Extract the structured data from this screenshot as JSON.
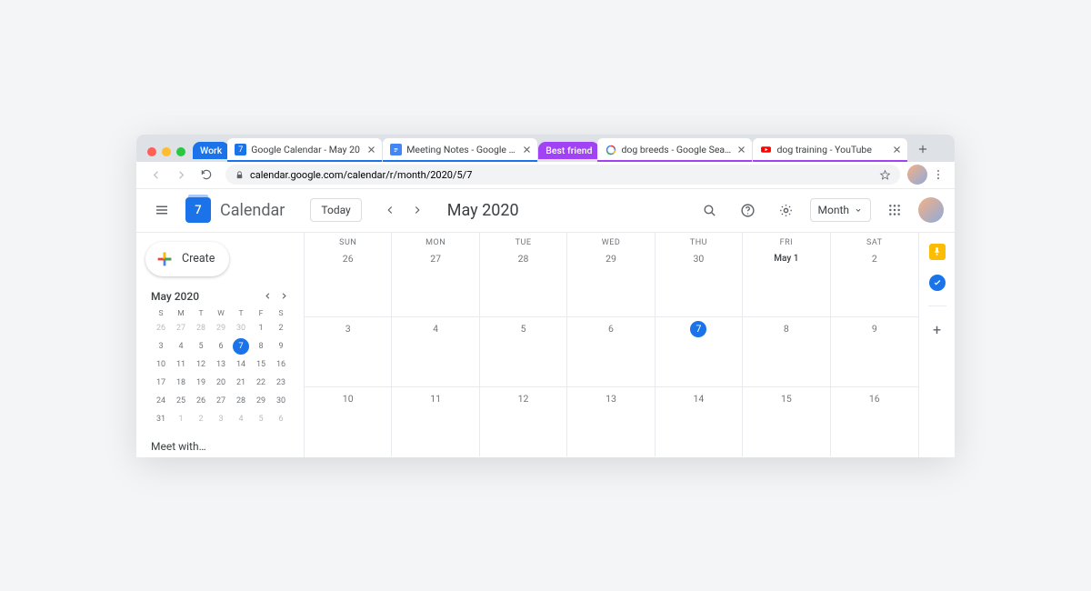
{
  "browser": {
    "tab_groups": [
      {
        "name": "work",
        "label": "Work",
        "color": "#1a73e8",
        "underline": "#1a73e8"
      },
      {
        "name": "bestfriend",
        "label": "Best friend",
        "color": "#a142f4",
        "underline": "#a142f4"
      }
    ],
    "tabs": [
      {
        "group": "work",
        "title": "Google Calendar - May 20",
        "favicon": "gcal",
        "active": true
      },
      {
        "group": "work",
        "title": "Meeting Notes - Google Do",
        "favicon": "gdoc"
      },
      {
        "group": "bestfriend",
        "title": "dog breeds - Google Search",
        "favicon": "gsearch"
      },
      {
        "group": "bestfriend",
        "title": "dog training - YouTube",
        "favicon": "youtube"
      }
    ],
    "url": "calendar.google.com/calendar/r/month/2020/5/7"
  },
  "app": {
    "brand": "Calendar",
    "brand_day": "7",
    "today_label": "Today",
    "month_title": "May 2020",
    "view_label": "Month",
    "create_label": "Create"
  },
  "mini": {
    "title": "May 2020",
    "dow": [
      "S",
      "M",
      "T",
      "W",
      "T",
      "F",
      "S"
    ],
    "days": [
      {
        "n": 26,
        "muted": true
      },
      {
        "n": 27,
        "muted": true
      },
      {
        "n": 28,
        "muted": true
      },
      {
        "n": 29,
        "muted": true
      },
      {
        "n": 30,
        "muted": true
      },
      {
        "n": 1
      },
      {
        "n": 2
      },
      {
        "n": 3
      },
      {
        "n": 4
      },
      {
        "n": 5
      },
      {
        "n": 6
      },
      {
        "n": 7,
        "today": true
      },
      {
        "n": 8
      },
      {
        "n": 9
      },
      {
        "n": 10
      },
      {
        "n": 11
      },
      {
        "n": 12
      },
      {
        "n": 13
      },
      {
        "n": 14
      },
      {
        "n": 15
      },
      {
        "n": 16
      },
      {
        "n": 17
      },
      {
        "n": 18
      },
      {
        "n": 19
      },
      {
        "n": 20
      },
      {
        "n": 21
      },
      {
        "n": 22
      },
      {
        "n": 23
      },
      {
        "n": 24
      },
      {
        "n": 25
      },
      {
        "n": 26
      },
      {
        "n": 27
      },
      {
        "n": 28
      },
      {
        "n": 29
      },
      {
        "n": 30
      },
      {
        "n": 31
      },
      {
        "n": 1,
        "muted": true
      },
      {
        "n": 2,
        "muted": true
      },
      {
        "n": 3,
        "muted": true
      },
      {
        "n": 4,
        "muted": true
      },
      {
        "n": 5,
        "muted": true
      },
      {
        "n": 6,
        "muted": true
      }
    ],
    "meet_with": "Meet with…"
  },
  "cal": {
    "dow": [
      "SUN",
      "MON",
      "TUE",
      "WED",
      "THU",
      "FRI",
      "SAT"
    ],
    "weeks": [
      [
        {
          "label": "26"
        },
        {
          "label": "27"
        },
        {
          "label": "28"
        },
        {
          "label": "29"
        },
        {
          "label": "30"
        },
        {
          "label": "May 1",
          "dark": true,
          "month1": true
        },
        {
          "label": "2"
        }
      ],
      [
        {
          "label": "3"
        },
        {
          "label": "4"
        },
        {
          "label": "5"
        },
        {
          "label": "6"
        },
        {
          "label": "7",
          "today": true
        },
        {
          "label": "8"
        },
        {
          "label": "9"
        }
      ],
      [
        {
          "label": "10"
        },
        {
          "label": "11"
        },
        {
          "label": "12"
        },
        {
          "label": "13"
        },
        {
          "label": "14"
        },
        {
          "label": "15"
        },
        {
          "label": "16"
        }
      ]
    ]
  },
  "rail": {
    "keep_color": "#fbbc04",
    "tasks_color": "#1a73e8"
  }
}
